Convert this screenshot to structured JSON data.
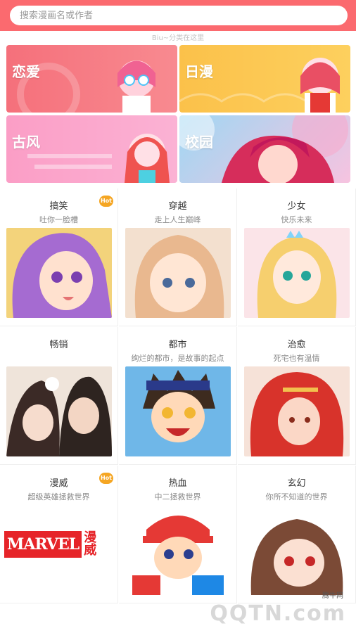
{
  "search": {
    "placeholder": "搜索漫画名或作者"
  },
  "hint": "Biu~分类在这里",
  "banners": [
    {
      "label": "恋爱",
      "color": "#f5707b"
    },
    {
      "label": "日漫",
      "color": "#fbc14a"
    },
    {
      "label": "古风",
      "color": "#fb9ec6"
    },
    {
      "label": "校园",
      "color": "#9fd7f3"
    }
  ],
  "categories": [
    {
      "title": "搞笑",
      "sub": "吐你一脸槽",
      "hot": "Hot",
      "pic": "#b784d6"
    },
    {
      "title": "穿越",
      "sub": "走上人生巅峰",
      "hot": "",
      "pic": "#ecc7a3"
    },
    {
      "title": "少女",
      "sub": "快乐未来",
      "hot": "",
      "pic": "#f5d27f"
    },
    {
      "title": "畅销",
      "sub": "",
      "hot": "",
      "pic": "#6b4e44"
    },
    {
      "title": "都市",
      "sub": "绚烂的都市，是故事的起点",
      "hot": "",
      "pic": "#f2c94c"
    },
    {
      "title": "治愈",
      "sub": "死宅也有温情",
      "hot": "",
      "pic": "#e4584d"
    },
    {
      "title": "漫威",
      "sub": "超级英雄拯救世界",
      "hot": "Hot",
      "pic": "#ffffff"
    },
    {
      "title": "热血",
      "sub": "中二拯救世界",
      "hot": "",
      "pic": "#e85a3a"
    },
    {
      "title": "玄幻",
      "sub": "你所不知道的世界",
      "hot": "",
      "pic": "#7a4a38"
    }
  ],
  "marvel": {
    "logo": "MARVEL",
    "cn": "漫威"
  },
  "watermark": {
    "small": "腾牛网",
    "big": "QQTN.com"
  }
}
